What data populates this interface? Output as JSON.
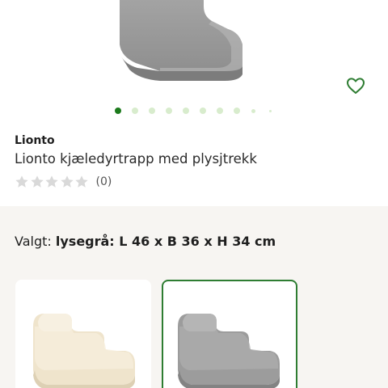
{
  "product": {
    "brand": "Lionto",
    "title": "Lionto kjæledyrtrapp med plysjtrekk",
    "rating_count": "(0)"
  },
  "gallery": {
    "active_index": 0,
    "favorite_icon": "heart-outline-icon"
  },
  "variant": {
    "label": "Valgt:",
    "selected_value": "lysegrå: L 46 x B 36 x H 34 cm",
    "options": [
      {
        "color_name": "beige"
      },
      {
        "color_name": "lysegrå",
        "selected": true
      }
    ]
  },
  "colors": {
    "accent": "#2e7d32",
    "dot_active": "#1c7a1c",
    "dot_inactive": "#d8eccd",
    "section_bg": "#f7f5f2",
    "star_empty": "#d9d9d9"
  }
}
